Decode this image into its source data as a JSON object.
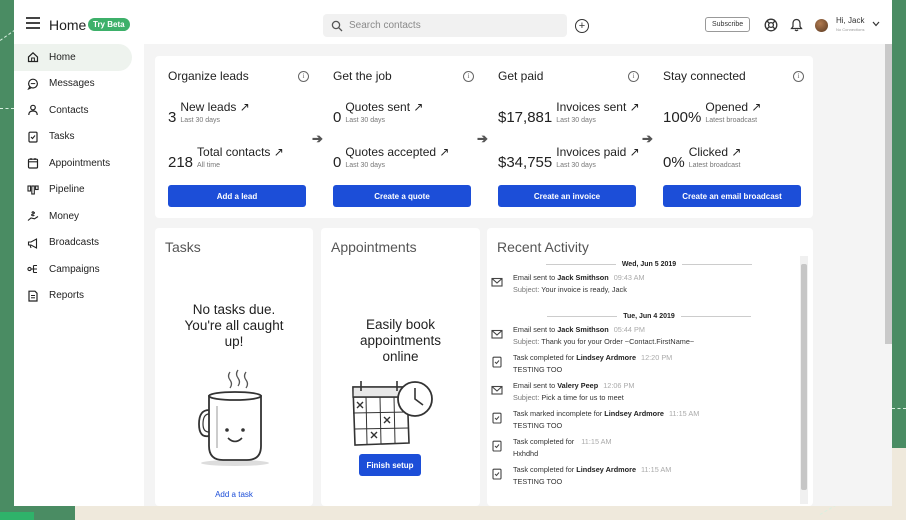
{
  "topbar": {
    "title": "Home",
    "beta_badge": "Try Beta",
    "search_placeholder": "Search contacts",
    "subscribe_label": "Subscribe",
    "user_greeting": "Hi, Jack",
    "user_sub": "No Connections"
  },
  "sidebar": {
    "items": [
      {
        "label": "Home",
        "icon": "home-icon"
      },
      {
        "label": "Messages",
        "icon": "chat-bubble-icon"
      },
      {
        "label": "Contacts",
        "icon": "person-icon"
      },
      {
        "label": "Tasks",
        "icon": "checklist-icon"
      },
      {
        "label": "Appointments",
        "icon": "calendar-icon"
      },
      {
        "label": "Pipeline",
        "icon": "pipeline-icon"
      },
      {
        "label": "Money",
        "icon": "money-hand-icon"
      },
      {
        "label": "Broadcasts",
        "icon": "megaphone-icon"
      },
      {
        "label": "Campaigns",
        "icon": "campaign-flow-icon"
      },
      {
        "label": "Reports",
        "icon": "report-icon"
      }
    ]
  },
  "stats": [
    {
      "title": "Organize leads",
      "m1": {
        "num": "3",
        "label": "New leads ↗",
        "sub": "Last 30 days"
      },
      "m2": {
        "num": "218",
        "label": "Total contacts ↗",
        "sub": "All time"
      },
      "button": "Add a lead"
    },
    {
      "title": "Get the job",
      "m1": {
        "num": "0",
        "label": "Quotes sent ↗",
        "sub": "Last 30 days"
      },
      "m2": {
        "num": "0",
        "label": "Quotes accepted ↗",
        "sub": "Last 30 days"
      },
      "button": "Create a quote"
    },
    {
      "title": "Get paid",
      "m1": {
        "num": "$17,881",
        "label": "Invoices sent ↗",
        "sub": "Last 30 days"
      },
      "m2": {
        "num": "$34,755",
        "label": "Invoices paid ↗",
        "sub": "Last 30 days"
      },
      "button": "Create an invoice"
    },
    {
      "title": "Stay connected",
      "m1": {
        "num": "100%",
        "label": "Opened ↗",
        "sub": "Latest broadcast"
      },
      "m2": {
        "num": "0%",
        "label": "Clicked ↗",
        "sub": "Latest broadcast"
      },
      "button": "Create an email broadcast"
    }
  ],
  "tasks": {
    "title": "Tasks",
    "empty_line1": "No tasks due.",
    "empty_line2": "You're all caught",
    "empty_line3": "up!",
    "link": "Add a task"
  },
  "appointments": {
    "title": "Appointments",
    "line1": "Easily book",
    "line2": "appointments",
    "line3": "online",
    "button": "Finish setup"
  },
  "activity": {
    "title": "Recent Activity",
    "groups": [
      {
        "date": "Wed, Jun 5 2019",
        "items": [
          {
            "icon": "mail-icon",
            "prefix": "Email sent to ",
            "name": "Jack Smithson",
            "time": "09:43 AM",
            "detail_label": "Subject: ",
            "detail": "Your invoice is ready, Jack"
          }
        ]
      },
      {
        "date": "Tue, Jun 4 2019",
        "items": [
          {
            "icon": "mail-icon",
            "prefix": "Email sent to ",
            "name": "Jack Smithson",
            "time": "05:44 PM",
            "detail_label": "Subject: ",
            "detail": "Thank you for your Order ~Contact.FirstName~"
          },
          {
            "icon": "task-check-icon",
            "prefix": "Task completed for ",
            "name": "Lindsey Ardmore",
            "time": "12:20 PM",
            "detail_label": "",
            "detail": "TESTING TOO"
          },
          {
            "icon": "mail-icon",
            "prefix": "Email sent to ",
            "name": "Valery Peep",
            "time": "12:06 PM",
            "detail_label": "Subject: ",
            "detail": "Pick a time for us to meet"
          },
          {
            "icon": "task-check-icon",
            "prefix": "Task marked incomplete for ",
            "name": "Lindsey Ardmore",
            "time": "11:15 AM",
            "detail_label": "",
            "detail": "TESTING TOO"
          },
          {
            "icon": "task-check-icon",
            "prefix": "Task completed for ",
            "name": "",
            "time": "11:15 AM",
            "detail_label": "",
            "detail": "Hxhdhd"
          },
          {
            "icon": "task-check-icon",
            "prefix": "Task completed for ",
            "name": "Lindsey Ardmore",
            "time": "11:15 AM",
            "detail_label": "",
            "detail": "TESTING TOO"
          }
        ]
      }
    ]
  },
  "colors": {
    "primary_button": "#1c4ed8",
    "beta_badge": "#3db06a",
    "backdrop": "#4a8c63"
  }
}
